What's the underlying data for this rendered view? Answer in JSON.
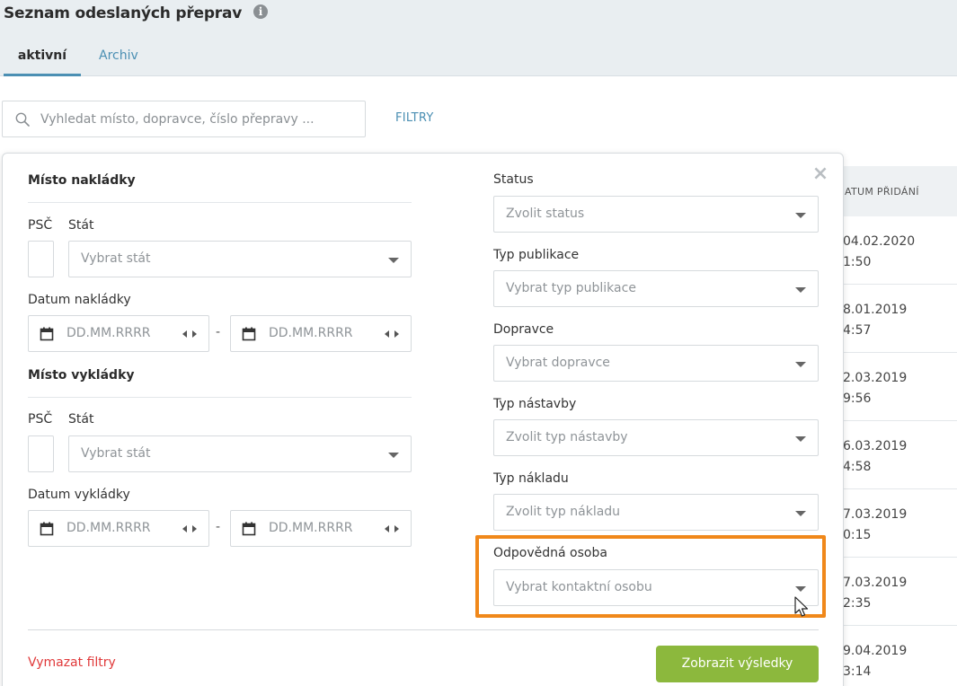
{
  "header": {
    "title": "Seznam odeslaných přeprav",
    "info_icon": "i",
    "tabs": [
      {
        "label": "aktivní",
        "active": true
      },
      {
        "label": "Archiv",
        "active": false
      }
    ]
  },
  "search": {
    "placeholder": "Vyhledat místo, dopravce, číslo přepravy ...",
    "filters_label": "FILTRY"
  },
  "table": {
    "column_header": "ATUM PŘIDÁNÍ",
    "rows": [
      {
        "date": "04.02.2020",
        "time": "1:50"
      },
      {
        "date": "8.01.2019",
        "time": "4:57"
      },
      {
        "date": "2.03.2019",
        "time": "9:56"
      },
      {
        "date": "6.03.2019",
        "time": "4:58"
      },
      {
        "date": "7.03.2019",
        "time": "0:15"
      },
      {
        "date": "7.03.2019",
        "time": "2:35"
      },
      {
        "date": "9.04.2019",
        "time": "3:14"
      }
    ]
  },
  "filters": {
    "loading": {
      "title": "Místo nakládky",
      "psc_label": "PSČ",
      "country_label": "Stát",
      "country_placeholder": "Vybrat stát",
      "date_label": "Datum nakládky",
      "date_from_placeholder": "DD.MM.RRRR",
      "date_to_placeholder": "DD.MM.RRRR",
      "separator": "-"
    },
    "unloading": {
      "title": "Místo vykládky",
      "psc_label": "PSČ",
      "country_label": "Stát",
      "country_placeholder": "Vybrat stát",
      "date_label": "Datum vykládky",
      "date_from_placeholder": "DD.MM.RRRR",
      "date_to_placeholder": "DD.MM.RRRR",
      "separator": "-"
    },
    "right": [
      {
        "label": "Status",
        "placeholder": "Zvolit status"
      },
      {
        "label": "Typ publikace",
        "placeholder": "Vybrat typ publikace"
      },
      {
        "label": "Dopravce",
        "placeholder": "Vybrat dopravce"
      },
      {
        "label": "Typ nástavby",
        "placeholder": "Zvolit typ nástavby"
      },
      {
        "label": "Typ nákladu",
        "placeholder": "Zvolit typ nákladu"
      },
      {
        "label": "Odpovědná osoba",
        "placeholder": "Vybrat kontaktní osobu"
      }
    ],
    "clear_label": "Vymazat filtry",
    "submit_label": "Zobrazit výsledky"
  },
  "colors": {
    "accent": "#4b8fb3",
    "highlight": "#f0881a",
    "submit": "#8cb83d",
    "clear": "#e0393a"
  },
  "icons": [
    "info-icon",
    "search-icon",
    "close-icon",
    "calendar-icon",
    "spinner-arrows-icon",
    "chevron-down-icon",
    "mouse-cursor-icon"
  ]
}
